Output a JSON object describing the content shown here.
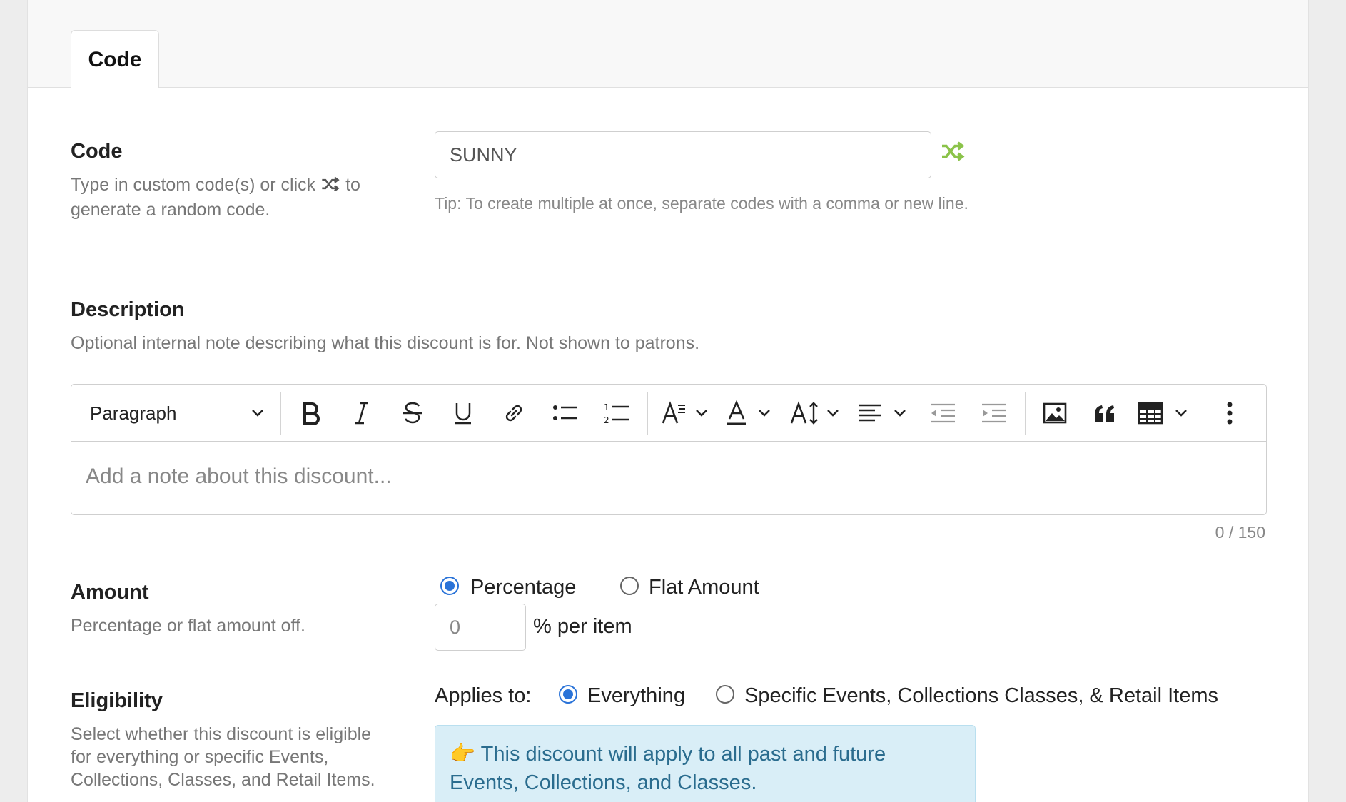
{
  "tabs": [
    {
      "label": "Code",
      "active": true
    }
  ],
  "code_section": {
    "label": "Code",
    "help_before": "Type in custom code(s) or click",
    "help_after": "to",
    "help_line2": "generate a random code.",
    "input_value": "SUNNY",
    "tip": "Tip: To create multiple at once, separate codes with a comma or new line.",
    "shuffle_icon": "shuffle-icon",
    "shuffle_color": "#8bc34a"
  },
  "description_section": {
    "label": "Description",
    "help": "Optional internal note describing what this discount is for. Not shown to patrons.",
    "editor": {
      "block_format": "Paragraph",
      "placeholder": "Add a note about this discount...",
      "counter": "0 / 150",
      "toolbar_icons": [
        "bold-icon",
        "italic-icon",
        "strikethrough-icon",
        "underline-icon",
        "link-icon",
        "bulleted-list-icon",
        "numbered-list-icon",
        "font-family-icon",
        "font-color-icon",
        "font-size-icon",
        "align-icon",
        "outdent-icon",
        "indent-icon",
        "image-icon",
        "blockquote-icon",
        "table-icon",
        "more-icon"
      ]
    }
  },
  "amount_section": {
    "label": "Amount",
    "help": "Percentage or flat amount off.",
    "options": [
      {
        "label": "Percentage",
        "selected": true
      },
      {
        "label": "Flat Amount",
        "selected": false
      }
    ],
    "value": "0",
    "unit": "% per item"
  },
  "eligibility_section": {
    "label": "Eligibility",
    "help_lines": [
      "Select whether this discount is eligible",
      "for everything or specific Events,",
      "Collections, Classes, and Retail Items."
    ],
    "applies_label": "Applies to:",
    "options": [
      {
        "label": "Everything",
        "selected": true
      },
      {
        "label": "Specific Events, Collections Classes, & Retail Items",
        "selected": false
      }
    ],
    "info_emoji": "👉",
    "info_line1": "This discount will apply to all past and future",
    "info_line2": "Events, Collections, and Classes."
  },
  "colors": {
    "accent": "#2a73d8",
    "info_bg": "#d9eef7",
    "info_text": "#2a6c8e"
  }
}
